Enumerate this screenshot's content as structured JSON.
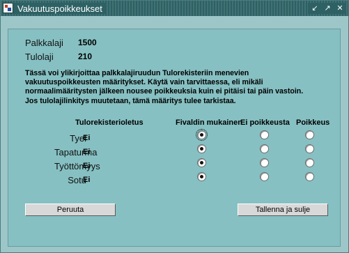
{
  "window": {
    "title": "Vakuutuspoikkeukset"
  },
  "fields": {
    "palkkalaji_label": "Palkkalaji",
    "palkkalaji_value": "1500",
    "tulolaji_label": "Tulolaji",
    "tulolaji_value": "210"
  },
  "description": "Tässä voi ylikirjoittaa palkkalajiruudun Tulorekisteriin menevien vakuutuspoikkeusten määritykset. Käytä vain tarvittaessa, eli mikäli normaalimääritysten jälkeen nousee poikkeuksia kuin ei pitäisi tai päin vastoin. Jos tulolajilinkitys muutetaan, tämä määritys tulee tarkistaa.",
  "columns": {
    "default": "Tulorekisterioletus",
    "fivaldi": "Fivaldin mukainen",
    "no_exception": "Ei poikkeusta",
    "exception": "Poikkeus"
  },
  "rows": [
    {
      "label": "Tyel",
      "default": "Ei",
      "selected": "fivaldi"
    },
    {
      "label": "Tapaturma",
      "default": "Ei",
      "selected": "fivaldi"
    },
    {
      "label": "Työttömyys",
      "default": "Ei",
      "selected": "fivaldi"
    },
    {
      "label": "Sotu",
      "default": "Ei",
      "selected": "fivaldi"
    }
  ],
  "buttons": {
    "cancel": "Peruuta",
    "save": "Tallenna ja sulje"
  }
}
